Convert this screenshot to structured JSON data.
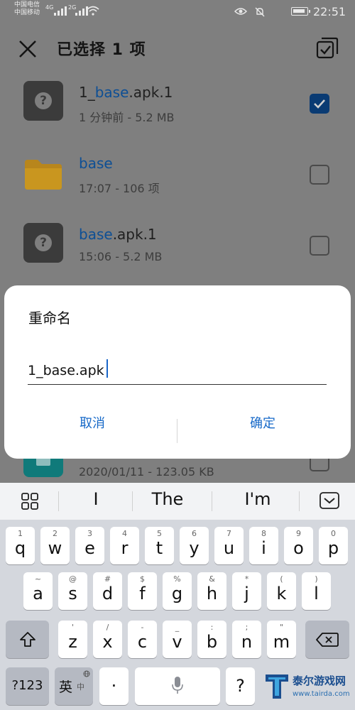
{
  "status_bar": {
    "carrier_1": "中国电信",
    "carrier_2": "中国移动",
    "network_1": "4G",
    "network_2": "2G",
    "time": "22:51"
  },
  "toolbar": {
    "title": "已选择 1 项"
  },
  "files": [
    {
      "name_pre": "1_",
      "name_hl": "base",
      "name_post": ".apk.1",
      "meta": "1 分钟前 - 5.2 MB",
      "type": "unknown-file",
      "checked": true
    },
    {
      "name_pre": "",
      "name_hl": "base",
      "name_post": "",
      "meta": "17:07 - 106 项",
      "type": "folder",
      "checked": false
    },
    {
      "name_pre": "",
      "name_hl": "base",
      "name_post": ".apk.1",
      "meta": "15:06 - 5.2 MB",
      "type": "unknown-file",
      "checked": false
    },
    {
      "meta": "2020/01/11 - 123.05 KB",
      "type": "document",
      "checked": false
    }
  ],
  "dialog": {
    "title": "重命名",
    "input_value": "1_base.apk",
    "cancel_label": "取消",
    "ok_label": "确定"
  },
  "keyboard": {
    "suggestions": [
      "I",
      "The",
      "I'm"
    ],
    "row1": [
      {
        "sub": "1",
        "main": "q"
      },
      {
        "sub": "2",
        "main": "w"
      },
      {
        "sub": "3",
        "main": "e"
      },
      {
        "sub": "4",
        "main": "r"
      },
      {
        "sub": "5",
        "main": "t"
      },
      {
        "sub": "6",
        "main": "y"
      },
      {
        "sub": "7",
        "main": "u"
      },
      {
        "sub": "8",
        "main": "i"
      },
      {
        "sub": "9",
        "main": "o"
      },
      {
        "sub": "0",
        "main": "p"
      }
    ],
    "row2": [
      {
        "sub": "~",
        "main": "a"
      },
      {
        "sub": "@",
        "main": "s"
      },
      {
        "sub": "#",
        "main": "d"
      },
      {
        "sub": "$",
        "main": "f"
      },
      {
        "sub": "%",
        "main": "g"
      },
      {
        "sub": "&",
        "main": "h"
      },
      {
        "sub": "*",
        "main": "j"
      },
      {
        "sub": "(",
        "main": "k"
      },
      {
        "sub": ")",
        "main": "l"
      }
    ],
    "row3": [
      {
        "sub": "'",
        "main": "z"
      },
      {
        "sub": "/",
        "main": "x"
      },
      {
        "sub": "-",
        "main": "c"
      },
      {
        "sub": "_",
        "main": "v"
      },
      {
        "sub": ":",
        "main": "b"
      },
      {
        "sub": ";",
        "main": "n"
      },
      {
        "sub": "\"",
        "main": "m"
      }
    ],
    "num_key": "?123",
    "lang_key": "英",
    "lang_key_alt": "中",
    "dot_key": "·",
    "question_key": "?"
  },
  "watermark": {
    "brand": "泰尔游戏网",
    "url": "www.tairda.com"
  },
  "colors": {
    "accent": "#1769c8",
    "folder": "#b8861c",
    "checkbox_on": "#0a3b73",
    "document_icon": "#107a7a"
  }
}
